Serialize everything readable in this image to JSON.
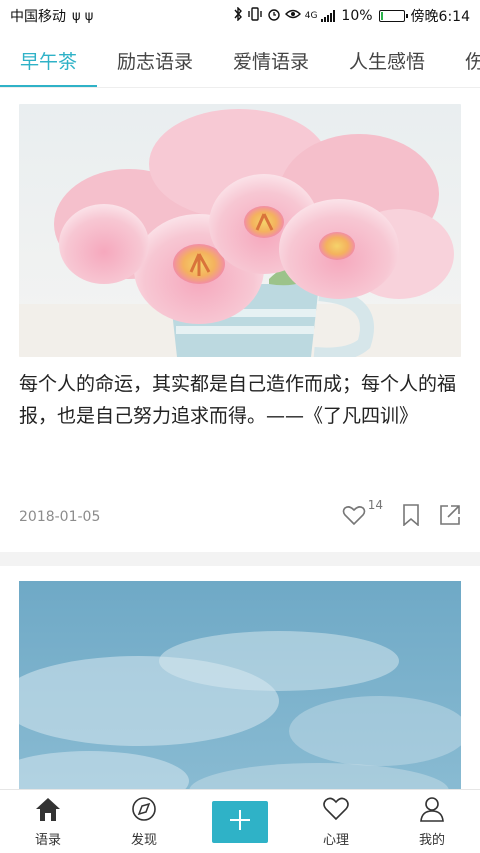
{
  "status_bar": {
    "carrier": "中国移动",
    "usb_icons": "ψ ψ",
    "network": "4G",
    "battery_percent": "10%",
    "battery_level": 0.1,
    "time": "傍晚6:14"
  },
  "tabs": [
    {
      "label": "早午茶",
      "active": true
    },
    {
      "label": "励志语录",
      "active": false
    },
    {
      "label": "爱情语录",
      "active": false
    },
    {
      "label": "人生感悟",
      "active": false
    },
    {
      "label": "伤感",
      "active": false
    }
  ],
  "cards": [
    {
      "quote": "每个人的命运，其实都是自己造作而成；每个人的福报，也是自己努力追求而得。——《了凡四训》",
      "date": "2018-01-05",
      "like_count": "14"
    }
  ],
  "bottom_nav": [
    {
      "label": "语录",
      "icon": "home-icon",
      "active": true
    },
    {
      "label": "发现",
      "icon": "compass-icon",
      "active": false
    },
    {
      "label": "",
      "icon": "plus-icon",
      "active": false
    },
    {
      "label": "心理",
      "icon": "heart-icon",
      "active": false
    },
    {
      "label": "我的",
      "icon": "user-icon",
      "active": false
    }
  ],
  "colors": {
    "accent": "#2fb2c7",
    "date_gray": "#8c8c8c"
  }
}
